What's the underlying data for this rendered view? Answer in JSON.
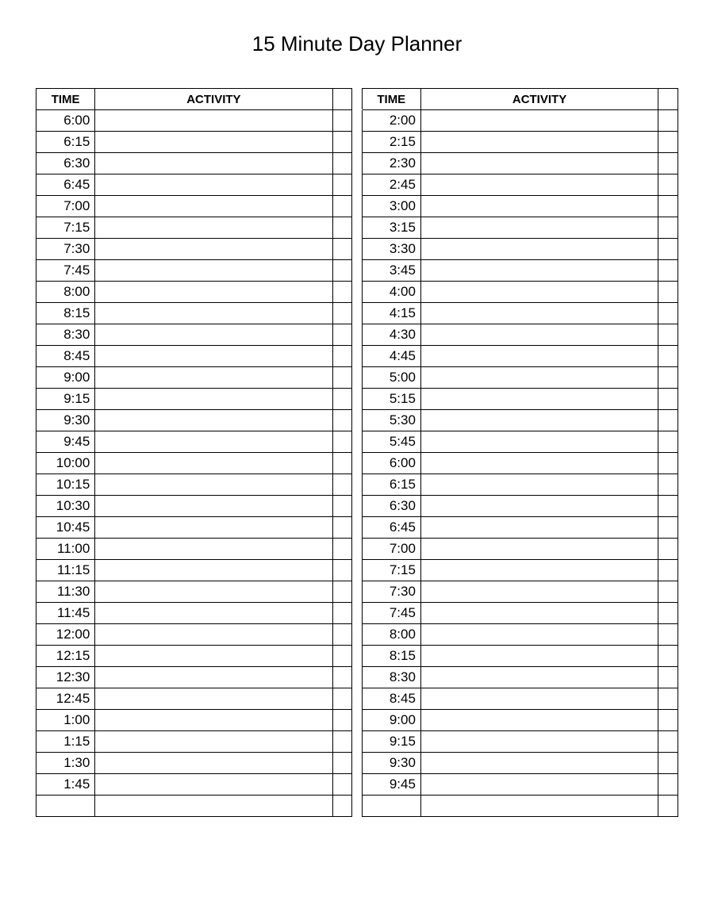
{
  "title": "15 Minute Day Planner",
  "headers": {
    "time": "TIME",
    "activity": "ACTIVITY"
  },
  "left_times": [
    "6:00",
    "6:15",
    "6:30",
    "6:45",
    "7:00",
    "7:15",
    "7:30",
    "7:45",
    "8:00",
    "8:15",
    "8:30",
    "8:45",
    "9:00",
    "9:15",
    "9:30",
    "9:45",
    "10:00",
    "10:15",
    "10:30",
    "10:45",
    "11:00",
    "11:15",
    "11:30",
    "11:45",
    "12:00",
    "12:15",
    "12:30",
    "12:45",
    "1:00",
    "1:15",
    "1:30",
    "1:45",
    ""
  ],
  "right_times": [
    "2:00",
    "2:15",
    "2:30",
    "2:45",
    "3:00",
    "3:15",
    "3:30",
    "3:45",
    "4:00",
    "4:15",
    "4:30",
    "4:45",
    "5:00",
    "5:15",
    "5:30",
    "5:45",
    "6:00",
    "6:15",
    "6:30",
    "6:45",
    "7:00",
    "7:15",
    "7:30",
    "7:45",
    "8:00",
    "8:15",
    "8:30",
    "8:45",
    "9:00",
    "9:15",
    "9:30",
    "9:45",
    ""
  ]
}
